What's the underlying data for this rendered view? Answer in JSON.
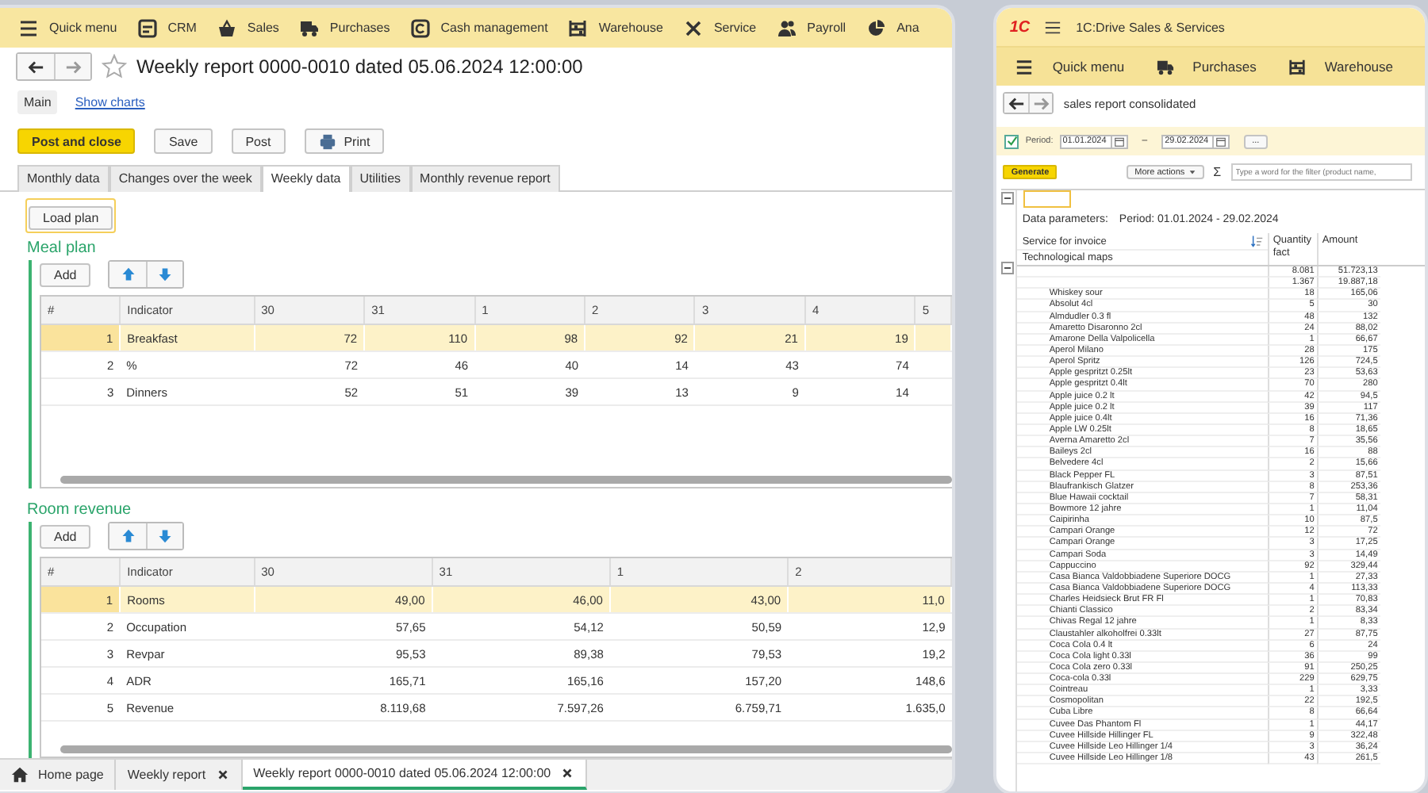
{
  "left_window": {
    "sections": [
      {
        "label": "Quick menu"
      },
      {
        "label": "CRM"
      },
      {
        "label": "Sales"
      },
      {
        "label": "Purchases"
      },
      {
        "label": "Cash management"
      },
      {
        "label": "Warehouse"
      },
      {
        "label": "Service"
      },
      {
        "label": "Payroll"
      },
      {
        "label": "Ana"
      }
    ],
    "title": "Weekly report 0000-0010 dated 05.06.2024 12:00:00",
    "view_tabs": [
      {
        "label": "Main",
        "selected": true
      },
      {
        "label": "Show charts",
        "selected": false
      }
    ],
    "buttons": [
      {
        "label": "Post and close",
        "kind": "primary"
      },
      {
        "label": "Save",
        "kind": "plain"
      },
      {
        "label": "Post",
        "kind": "plain"
      },
      {
        "label": "Print",
        "kind": "print"
      }
    ],
    "tabs": [
      {
        "label": "Monthly data",
        "selected": false
      },
      {
        "label": "Changes over the week",
        "selected": false
      },
      {
        "label": "Weekly data",
        "selected": true
      },
      {
        "label": "Utilities",
        "selected": false
      },
      {
        "label": "Monthly revenue report",
        "selected": false
      }
    ],
    "load_plan_button": "Load plan",
    "tables": [
      {
        "title": "Meal plan",
        "add_button": "Add",
        "columns": [
          "#",
          "Indicator",
          "30",
          "31",
          "1",
          "2",
          "3",
          "4",
          "5"
        ],
        "rows": [
          {
            "selected": true,
            "cells": [
              "1",
              "Breakfast",
              "72",
              "110",
              "98",
              "92",
              "21",
              "19"
            ]
          },
          {
            "selected": false,
            "cells": [
              "2",
              "%",
              "72",
              "46",
              "40",
              "14",
              "43",
              "74"
            ]
          },
          {
            "selected": false,
            "cells": [
              "3",
              "Dinners",
              "52",
              "51",
              "39",
              "13",
              "9",
              "14"
            ]
          }
        ]
      },
      {
        "title": "Room revenue",
        "add_button": "Add",
        "columns": [
          "#",
          "Indicator",
          "30",
          "31",
          "1",
          "2"
        ],
        "rows": [
          {
            "selected": true,
            "cells": [
              "1",
              "Rooms",
              "49,00",
              "46,00",
              "43,00",
              "11,0"
            ]
          },
          {
            "selected": false,
            "cells": [
              "2",
              "Occupation",
              "57,65",
              "54,12",
              "50,59",
              "12,9"
            ]
          },
          {
            "selected": false,
            "cells": [
              "3",
              "Revpar",
              "95,53",
              "89,38",
              "79,53",
              "19,2"
            ]
          },
          {
            "selected": false,
            "cells": [
              "4",
              "ADR",
              "165,71",
              "165,16",
              "157,20",
              "148,6"
            ]
          },
          {
            "selected": false,
            "cells": [
              "5",
              "Revenue",
              "8.119,68",
              "7.597,26",
              "6.759,71",
              "1.635,0"
            ]
          }
        ]
      }
    ],
    "open_windows": [
      {
        "label": "Home page",
        "kind": "home",
        "selected": false
      },
      {
        "label": "Weekly report",
        "kind": "closable",
        "selected": false
      },
      {
        "label": "Weekly report 0000-0010 dated 05.06.2024 12:00:00",
        "kind": "closable",
        "selected": true
      }
    ]
  },
  "right_window": {
    "logo": "1C",
    "app_title": "1C:Drive Sales & Services",
    "sections": [
      {
        "label": "Quick menu"
      },
      {
        "label": "Purchases"
      },
      {
        "label": "Warehouse"
      }
    ],
    "report_title": "sales report consolidated",
    "period": {
      "enabled": true,
      "label": "Period:",
      "from": "01.01.2024",
      "separator": "–",
      "to": "29.02.2024",
      "more_button": "..."
    },
    "toolbar": {
      "generate": "Generate",
      "more_actions": "More actions",
      "sum_symbol": "Σ",
      "search_placeholder": "Type a word for the filter (product name,"
    },
    "report": {
      "parameters_label": "Data parameters:",
      "parameters_value": "Period: 01.01.2024 - 29.02.2024",
      "columns": [
        "Service for invoice",
        "Quantity fact",
        "Amount"
      ],
      "subheader": "Technological maps",
      "rows": [
        {
          "quantity": "8.081",
          "amount": "51.723,13"
        },
        {
          "quantity": "1.367",
          "amount": "19.887,18"
        },
        {
          "name": "Whiskey sour",
          "quantity": "18",
          "amount": "165,06"
        },
        {
          "name": "Absolut 4cl",
          "quantity": "5",
          "amount": "30"
        },
        {
          "name": "Almdudler 0.3 fl",
          "quantity": "48",
          "amount": "132"
        },
        {
          "name": "Amaretto Disaronno 2cl",
          "quantity": "24",
          "amount": "88,02"
        },
        {
          "name": "Amarone Della Valpolicella",
          "quantity": "1",
          "amount": "66,67"
        },
        {
          "name": "Aperol Milano",
          "quantity": "28",
          "amount": "175"
        },
        {
          "name": "Aperol Spritz",
          "quantity": "126",
          "amount": "724,5"
        },
        {
          "name": "Apple gespritzt 0.25lt",
          "quantity": "23",
          "amount": "53,63"
        },
        {
          "name": "Apple gespritzt 0.4lt",
          "quantity": "70",
          "amount": "280"
        },
        {
          "name": "Apple juice 0.2 lt",
          "quantity": "42",
          "amount": "94,5"
        },
        {
          "name": "Apple juice 0.2 lt",
          "quantity": "39",
          "amount": "117"
        },
        {
          "name": "Apple juice 0.4lt",
          "quantity": "16",
          "amount": "71,36"
        },
        {
          "name": "Apple LW 0.25lt",
          "quantity": "8",
          "amount": "18,65"
        },
        {
          "name": "Averna Amaretto 2cl",
          "quantity": "7",
          "amount": "35,56"
        },
        {
          "name": "Baileys 2cl",
          "quantity": "16",
          "amount": "88"
        },
        {
          "name": "Belvedere 4cl",
          "quantity": "2",
          "amount": "15,66"
        },
        {
          "name": "Black Pepper FL",
          "quantity": "3",
          "amount": "87,51"
        },
        {
          "name": "Blaufrankisch Glatzer",
          "quantity": "8",
          "amount": "253,36"
        },
        {
          "name": "Blue Hawaii cocktail",
          "quantity": "7",
          "amount": "58,31"
        },
        {
          "name": "Bowmore 12 jahre",
          "quantity": "1",
          "amount": "11,04"
        },
        {
          "name": "Caipirinha",
          "quantity": "10",
          "amount": "87,5"
        },
        {
          "name": "Campari Orange",
          "quantity": "12",
          "amount": "72"
        },
        {
          "name": "Campari Orange",
          "quantity": "3",
          "amount": "17,25"
        },
        {
          "name": "Campari Soda",
          "quantity": "3",
          "amount": "14,49"
        },
        {
          "name": "Cappuccino",
          "quantity": "92",
          "amount": "329,44"
        },
        {
          "name": "Casa Bianca Valdobbiadene Superiore DOCG",
          "quantity": "1",
          "amount": "27,33"
        },
        {
          "name": "Casa Bianca Valdobbiadene Superiore DOCG",
          "quantity": "4",
          "amount": "113,33"
        },
        {
          "name": "Charles Heidsieck Brut FR Fl",
          "quantity": "1",
          "amount": "70,83"
        },
        {
          "name": "Chianti Classico",
          "quantity": "2",
          "amount": "83,34"
        },
        {
          "name": "Chivas Regal 12 jahre",
          "quantity": "1",
          "amount": "8,33"
        },
        {
          "name": "Claustahler alkoholfrei 0.33lt",
          "quantity": "27",
          "amount": "87,75"
        },
        {
          "name": "Coca Cola 0.4 lt",
          "quantity": "6",
          "amount": "24"
        },
        {
          "name": "Coca Cola light 0.33l",
          "quantity": "36",
          "amount": "99"
        },
        {
          "name": "Coca Cola zero 0.33l",
          "quantity": "91",
          "amount": "250,25"
        },
        {
          "name": "Coca-cola 0.33l",
          "quantity": "229",
          "amount": "629,75"
        },
        {
          "name": "Cointreau",
          "quantity": "1",
          "amount": "3,33"
        },
        {
          "name": "Cosmopolitan",
          "quantity": "22",
          "amount": "192,5"
        },
        {
          "name": "Cuba Libre",
          "quantity": "8",
          "amount": "66,64"
        },
        {
          "name": "Cuvee Das Phantom Fl",
          "quantity": "1",
          "amount": "44,17"
        },
        {
          "name": "Cuvee Hillside Hillinger FL",
          "quantity": "9",
          "amount": "322,48"
        },
        {
          "name": "Cuvee Hillside Leo Hillinger 1/4",
          "quantity": "3",
          "amount": "36,24"
        },
        {
          "name": "Cuvee Hillside Leo Hillinger 1/8",
          "quantity": "43",
          "amount": "261,5"
        }
      ]
    }
  }
}
